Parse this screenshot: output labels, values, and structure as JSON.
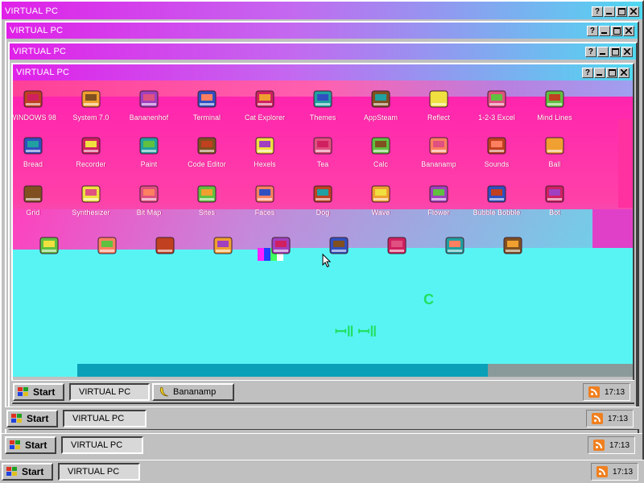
{
  "windows": [
    {
      "title": "VIRTUAL PC"
    },
    {
      "title": "VIRTUAL PC"
    },
    {
      "title": "VIRTUAL PC"
    },
    {
      "title": "VIRTUAL PC"
    }
  ],
  "titlebar_buttons": {
    "help": "?",
    "minimize_icon": "minimize-icon",
    "maximize_icon": "maximize-icon",
    "close_icon": "close-icon"
  },
  "desktop": {
    "icons_row1": [
      {
        "label": "WINDOWS 98",
        "icon": "computer-icon"
      },
      {
        "label": "System 7.0",
        "icon": "keyboard-icon"
      },
      {
        "label": "Bananenhof",
        "icon": "printer-icon"
      },
      {
        "label": "Terminal",
        "icon": "terminal-icon"
      },
      {
        "label": "Cat Explorer",
        "icon": "cat-icon"
      },
      {
        "label": "Themes",
        "icon": "paint-icon"
      },
      {
        "label": "AppSteam",
        "icon": "cherry-icon"
      },
      {
        "label": "Reflect",
        "icon": "acrobat-icon"
      },
      {
        "label": "1-2-3 Excel",
        "icon": "lotus-icon"
      },
      {
        "label": "Mind Lines",
        "icon": "sandwich-icon"
      }
    ],
    "icons_row2": [
      {
        "label": "Bread",
        "icon": "bread-icon"
      },
      {
        "label": "Recorder",
        "icon": "stickman-icon"
      },
      {
        "label": "Paint",
        "icon": "palette-icon"
      },
      {
        "label": "Code Editor",
        "icon": "hand-icon"
      },
      {
        "label": "Hexels",
        "icon": "cube-icon"
      },
      {
        "label": "Tea",
        "icon": "teapot-icon"
      },
      {
        "label": "Calc",
        "icon": "calculator-icon"
      },
      {
        "label": "Bananamp",
        "icon": "banana-icon"
      },
      {
        "label": "Sounds",
        "icon": "speaker-icon"
      },
      {
        "label": "Ball",
        "icon": "ball-icon"
      }
    ],
    "icons_row3": [
      {
        "label": "Grid",
        "icon": "grid-icon"
      },
      {
        "label": "Synthesizer",
        "icon": "synth-icon"
      },
      {
        "label": "Bit Map",
        "icon": "picture-icon"
      },
      {
        "label": "Sites",
        "icon": "pd-icon"
      },
      {
        "label": "Faces",
        "icon": "face-icon"
      },
      {
        "label": "Dog",
        "icon": "dog-icon"
      },
      {
        "label": "Wave",
        "icon": "wave-icon"
      },
      {
        "label": "Flower",
        "icon": "flower-icon"
      },
      {
        "label": "Bubble Bobble",
        "icon": "bubbles-icon"
      },
      {
        "label": "Bot",
        "icon": "stick-figure-icon"
      }
    ],
    "icons_row4": [
      {
        "label": "",
        "icon": "leaf-icon"
      },
      {
        "label": "",
        "icon": "cabinet-icon"
      },
      {
        "label": "",
        "icon": "owl-icon"
      },
      {
        "label": "",
        "icon": "lambda-icon"
      },
      {
        "label": "",
        "icon": "window-icon"
      },
      {
        "label": "",
        "icon": "notepad-icon"
      },
      {
        "label": "",
        "icon": "book-icon"
      },
      {
        "label": "",
        "icon": "frog-icon"
      },
      {
        "label": "",
        "icon": "fox-icon"
      }
    ]
  },
  "taskbars": [
    {
      "start": "Start",
      "tasks": [
        "VIRTUAL PC",
        "Bananamp"
      ],
      "time": "17:13"
    },
    {
      "start": "Start",
      "tasks": [
        "VIRTUAL PC"
      ],
      "time": "17:13"
    },
    {
      "start": "Start",
      "tasks": [
        "VIRTUAL PC"
      ],
      "time": "17:13"
    },
    {
      "start": "Start",
      "tasks": [
        "VIRTUAL PC"
      ],
      "time": "17:13"
    }
  ],
  "colors": {
    "title_gradient_start": "#e020e8",
    "title_gradient_end": "#50d8f0",
    "desktop_pink": "#ff40a8",
    "desktop_cyan": "#58f4f4",
    "rss_orange": "#f08020"
  }
}
